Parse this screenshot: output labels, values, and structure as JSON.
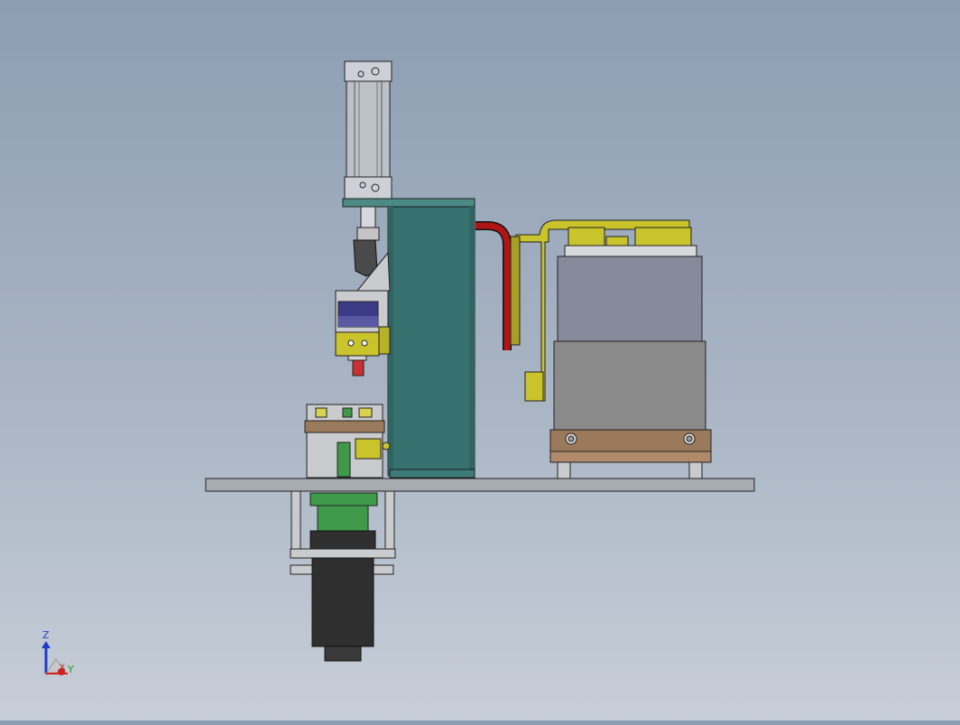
{
  "view": {
    "background_top": "#8d9db2",
    "background_bottom": "#c7ced8"
  },
  "triad": {
    "z_label": "Z",
    "y_label": "Y",
    "x_label": "X",
    "z_color": "#1e3cc8",
    "y_color": "#2aa02a",
    "x_color": "#d02020"
  },
  "colors": {
    "column": "#37716f",
    "plate": "#a7acb3",
    "brass": "#c9c32c",
    "wood": "#9a7a5a",
    "hose": "#b01515",
    "motor": "#2f2f2f",
    "green_coupler": "#3f9a4a",
    "solenoid_blue": "#3c3c86",
    "cylinder": "#bcc1c8"
  }
}
